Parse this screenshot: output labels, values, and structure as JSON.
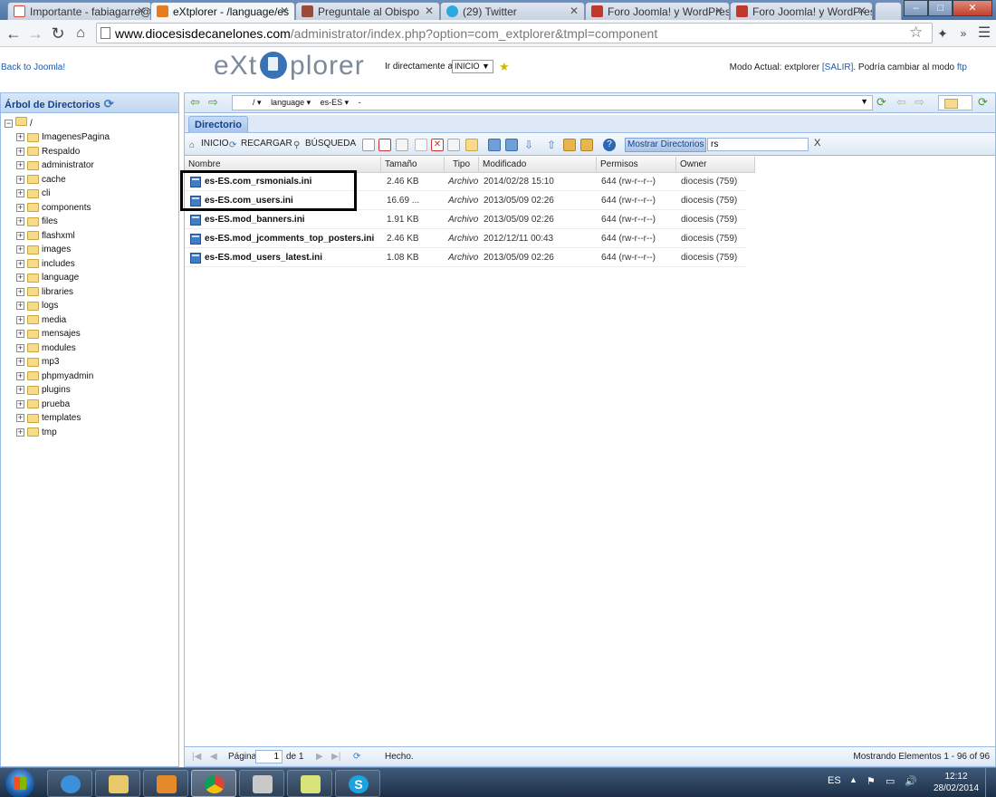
{
  "browser": {
    "tabs": [
      {
        "label": "Importante - fabiagarre@",
        "icon": "gmail-icon",
        "color": "#d44638"
      },
      {
        "label": "eXtplorer - /language/es",
        "icon": "joomla-icon",
        "color": "#e67c1f"
      },
      {
        "label": "Preguntale al Obispo",
        "icon": "page-icon",
        "color": "#9c4a3a"
      },
      {
        "label": "(29) Twitter",
        "icon": "twitter-icon",
        "color": "#2aa9e0"
      },
      {
        "label": "Foro Joomla! y WordPres",
        "icon": "forum-icon",
        "color": "#c0392b"
      },
      {
        "label": "Foro Joomla! y WordPres",
        "icon": "forum-icon",
        "color": "#c0392b"
      }
    ],
    "url_host": "www.diocesisdecanelones.com",
    "url_path": "/administrator/index.php?option=com_extplorer&tmpl=component"
  },
  "header": {
    "back_link": "Back to Joomla!",
    "logo_left": "eXt",
    "logo_right": "plorer",
    "goto_label": "Ir directamente a:",
    "goto_value": "INICIO",
    "mode_prefix": "Modo Actual: extplorer",
    "mode_logout": "[SALIR]",
    "mode_middle": ". Podría cambiar al modo",
    "mode_ftp": "ftp"
  },
  "tree": {
    "title": "Árbol de Directorios",
    "root": "/",
    "items": [
      "ImagenesPagina",
      "Respaldo",
      "administrator",
      "cache",
      "cli",
      "components",
      "files",
      "flashxml",
      "images",
      "includes",
      "language",
      "libraries",
      "logs",
      "media",
      "mensajes",
      "modules",
      "mp3",
      "phpmyadmin",
      "plugins",
      "prueba",
      "templates",
      "tmp"
    ]
  },
  "pathbar": {
    "segments": [
      "/",
      "language",
      "es-ES",
      "-"
    ]
  },
  "tabs": {
    "directory": "Directorio"
  },
  "toolbar": {
    "home": "INICIO",
    "reload": "RECARGAR",
    "search": "BÚSQUEDA",
    "show_dirs": "Mostrar Directorios",
    "filter_value": "rs",
    "clear": "X"
  },
  "grid": {
    "headers": {
      "name": "Nombre",
      "size": "Tamaño",
      "type": "Tipo",
      "modified": "Modificado",
      "perms": "Permisos",
      "owner": "Owner"
    },
    "rows": [
      {
        "name": "es-ES.com_rsmonials.ini",
        "size": "2.46 KB",
        "type": "Archivo",
        "modified": "2014/02/28 15:10",
        "perms": "644 (rw-r--r--)",
        "owner": "diocesis (759)"
      },
      {
        "name": "es-ES.com_users.ini",
        "size": "16.69 ...",
        "type": "Archivo",
        "modified": "2013/05/09 02:26",
        "perms": "644 (rw-r--r--)",
        "owner": "diocesis (759)"
      },
      {
        "name": "es-ES.mod_banners.ini",
        "size": "1.91 KB",
        "type": "Archivo",
        "modified": "2013/05/09 02:26",
        "perms": "644 (rw-r--r--)",
        "owner": "diocesis (759)"
      },
      {
        "name": "es-ES.mod_jcomments_top_posters.ini",
        "size": "2.46 KB",
        "type": "Archivo",
        "modified": "2012/12/11 00:43",
        "perms": "644 (rw-r--r--)",
        "owner": "diocesis (759)"
      },
      {
        "name": "es-ES.mod_users_latest.ini",
        "size": "1.08 KB",
        "type": "Archivo",
        "modified": "2013/05/09 02:26",
        "perms": "644 (rw-r--r--)",
        "owner": "diocesis (759)"
      }
    ]
  },
  "status": {
    "page_label": "Página",
    "page_value": "1",
    "of_label": "de 1",
    "done": "Hecho.",
    "showing": "Mostrando Elementos 1 - 96 of 96"
  },
  "taskbar": {
    "lang": "ES",
    "time": "12:12",
    "date": "28/02/2014"
  }
}
